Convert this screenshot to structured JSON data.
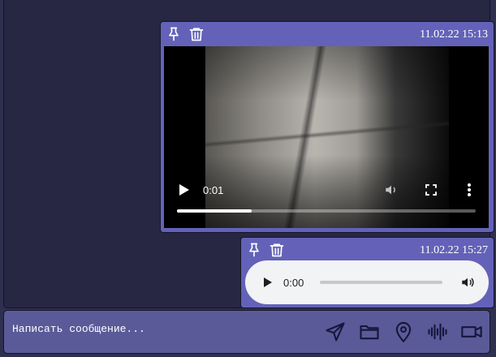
{
  "messages": [
    {
      "type": "video",
      "timestamp": "11.02.22 15:13",
      "actions": [
        "pin-icon",
        "trash-icon"
      ],
      "player": {
        "current_time": "0:01",
        "progress": 0.25
      }
    },
    {
      "type": "audio",
      "timestamp": "11.02.22 15:27",
      "actions": [
        "pin-icon",
        "trash-icon"
      ],
      "player": {
        "current_time": "0:00",
        "progress": 0
      }
    }
  ],
  "composer": {
    "placeholder": "Написать сообщение...",
    "actions": [
      "send-icon",
      "folder-icon",
      "location-pin-icon",
      "voice-wave-icon",
      "video-camera-icon"
    ]
  },
  "colors": {
    "page_bg": "#2f2f4f",
    "chat_bg": "#272743",
    "message_bg": "#6362b8",
    "composer_bg": "#5a5a99",
    "text": "#ffffff"
  }
}
